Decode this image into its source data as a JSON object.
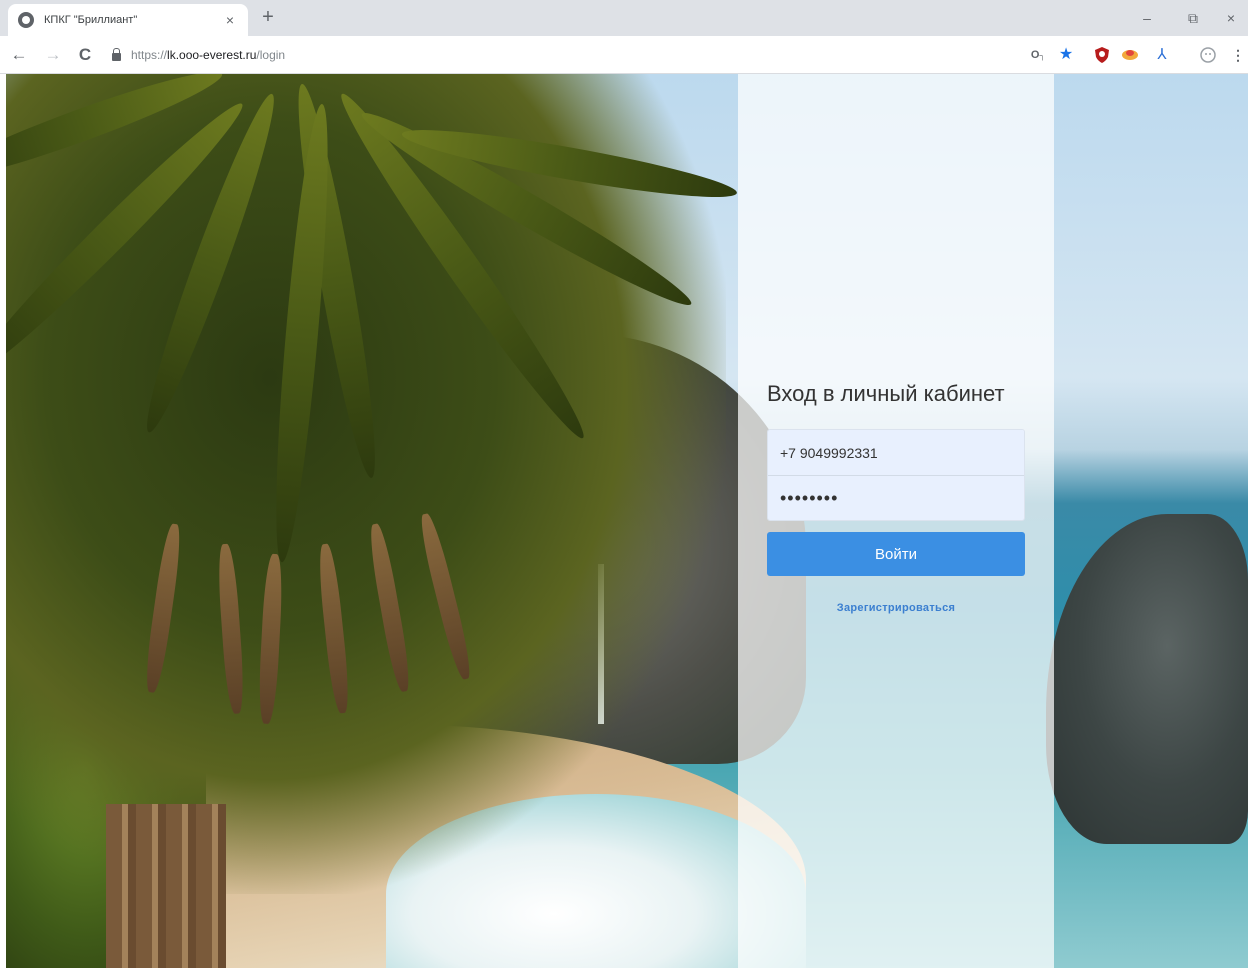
{
  "browser": {
    "tab_title": "КПКГ \"Бриллиант\"",
    "tab_close": "×",
    "new_tab": "+",
    "url_scheme": "https://",
    "url_host": "lk.ooo-everest.ru",
    "url_path": "/login",
    "window_controls": {
      "minimize": "–",
      "maximize": "⧉",
      "close": "×"
    },
    "nav": {
      "back": "←",
      "forward": "→",
      "reload": "C"
    },
    "extensions": [
      "key-icon",
      "star-icon",
      "shield-icon",
      "cloud-icon",
      "pdf-icon",
      "profile-icon",
      "menu-icon"
    ]
  },
  "login": {
    "heading": "Вход в личный кабинет",
    "phone_value": "+7 9049992331",
    "password_value": "••••••••",
    "submit_label": "Войти",
    "register_label": "Зарегистрироваться"
  },
  "colors": {
    "accent": "#3b8fe3",
    "link": "#3b7fd0",
    "input_bg": "#e8f0fe"
  }
}
